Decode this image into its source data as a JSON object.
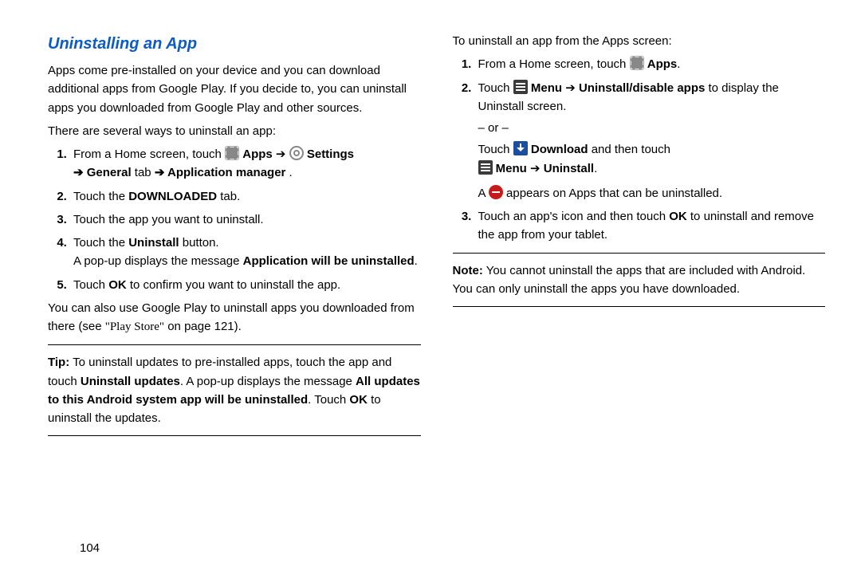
{
  "left": {
    "heading": "Uninstalling an App",
    "intro": "Apps come pre-installed on your device and you can download additional apps from Google Play. If you decide to, you can uninstall apps you downloaded from Google Play and other sources.",
    "lead": "There are several ways to uninstall an app:",
    "step1_pre": "From a Home screen, touch ",
    "step1_apps": "Apps",
    "step1_arrow1": " ➔ ",
    "step1_settings": "Settings",
    "step1_line2_arrow": "➔ ",
    "step1_general": "General",
    "step1_tab": " tab ",
    "step1_arrow2": "➔ ",
    "step1_appmgr": "Application manager",
    "step1_period": ".",
    "step2_a": "Touch the ",
    "step2_b": "DOWNLOADED",
    "step2_c": " tab.",
    "step3": "Touch the app you want to uninstall.",
    "step4_a": "Touch the ",
    "step4_b": "Uninstall",
    "step4_c": " button.",
    "step4_sub_a": "A pop-up displays the message ",
    "step4_sub_b": "Application will be uninstalled",
    "step4_sub_c": ".",
    "step5_a": "Touch ",
    "step5_b": "OK",
    "step5_c": " to confirm you want to uninstall the app.",
    "gplay_a": "You can also use Google Play to uninstall apps you downloaded from there (see ",
    "gplay_b": "\"Play Store\"",
    "gplay_c": " on page 121).",
    "tip_label": "Tip:",
    "tip_a": " To uninstall updates to pre-installed apps, touch the app and touch ",
    "tip_b": "Uninstall updates",
    "tip_c": ". A pop-up displays the message ",
    "tip_d": "All updates to this Android system app will be uninstalled",
    "tip_e": ". Touch ",
    "tip_f": "OK",
    "tip_g": " to uninstall the updates."
  },
  "right": {
    "intro": "To uninstall an app from the Apps screen:",
    "s1_a": "From a Home screen, touch ",
    "s1_b": "Apps",
    "s1_c": ".",
    "s2_a": "Touch ",
    "s2_menu": "Menu",
    "s2_arrow": " ➔ ",
    "s2_b": "Uninstall/disable apps",
    "s2_c": " to display the Uninstall screen.",
    "or": "– or –",
    "s2_d": "Touch ",
    "s2_dl": "Download",
    "s2_e": " and then touch ",
    "s2_menu2": "Menu",
    "s2_arrow2": " ➔ ",
    "s2_uninstall": "Uninstall",
    "s2_period": ".",
    "s2_f": "A ",
    "s2_g": " appears on Apps that can be uninstalled.",
    "s3_a": "Touch an app's icon and then touch ",
    "s3_b": "OK",
    "s3_c": " to uninstall and remove the app from your tablet.",
    "note_label": "Note:",
    "note_a": " You cannot uninstall the apps that are included with Android. You can only uninstall the apps you have downloaded."
  },
  "page_number": "104"
}
